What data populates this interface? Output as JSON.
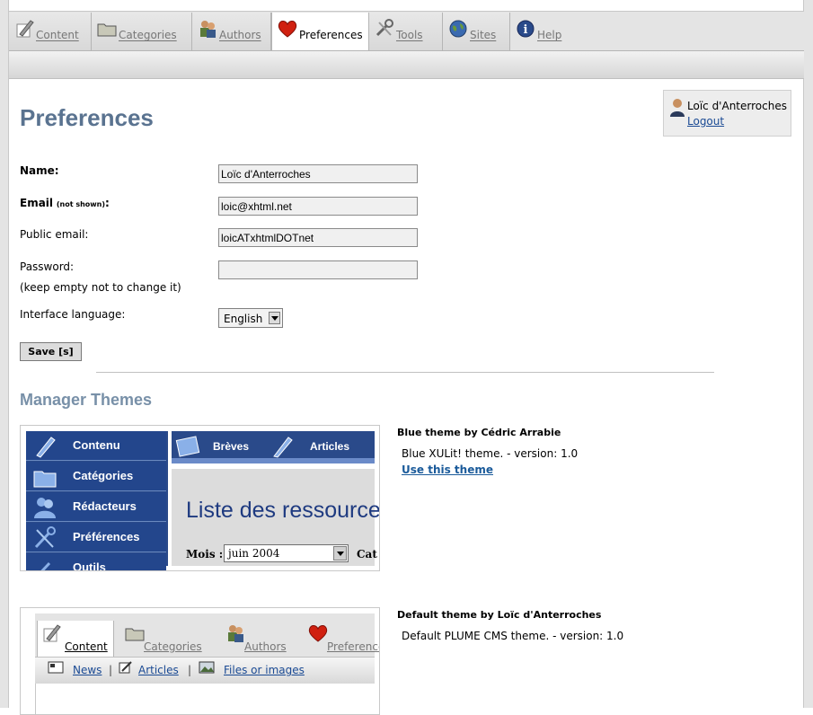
{
  "tabs": [
    {
      "label": "Content",
      "icon": "pen-icon"
    },
    {
      "label": "Categories",
      "icon": "folder-icon"
    },
    {
      "label": "Authors",
      "icon": "authors-icon"
    },
    {
      "label": "Preferences",
      "icon": "heart-icon",
      "active": true
    },
    {
      "label": "Tools",
      "icon": "tools-icon"
    },
    {
      "label": "Sites",
      "icon": "globe-icon"
    },
    {
      "label": "Help",
      "icon": "info-icon"
    }
  ],
  "user": {
    "name": "Loïc d'Anterroches",
    "logout": "Logout"
  },
  "page_title": "Preferences",
  "form": {
    "name_label": "Name:",
    "name_value": "Loïc d'Anterroches",
    "email_label": "Email",
    "email_note": "(not shown)",
    "email_colon": ":",
    "email_value": "loic@xhtml.net",
    "public_email_label": "Public email:",
    "public_email_value": "loicATxhtmlDOTnet",
    "password_label": "Password:",
    "password_hint": "(keep empty not to change it)",
    "password_value": "",
    "language_label": "Interface language:",
    "language_value": "English",
    "save_label": "Save [s]"
  },
  "themes_title": "Manager Themes",
  "themes": [
    {
      "title": "Blue theme by Cédric Arrabie",
      "desc": "Blue XULit! theme. - version: 1.0",
      "action": "Use this theme",
      "preview": {
        "nav": [
          "Contenu",
          "Catégories",
          "Rédacteurs",
          "Préférences",
          "Outils"
        ],
        "top": [
          "Brèves",
          "Articles"
        ],
        "heading": "Liste des ressources",
        "mois_label": "Mois :",
        "mois_value": "juin 2004",
        "cat_label": "Cat"
      }
    },
    {
      "title": "Default theme by Loïc d'Anterroches",
      "desc": "Default PLUME CMS theme. - version: 1.0",
      "preview": {
        "tabs": [
          "Content",
          "Categories",
          "Authors",
          "Preferences"
        ],
        "sub": [
          "News",
          "Articles",
          "Files or images"
        ]
      }
    }
  ],
  "colors": {
    "title": "#5a7390",
    "section": "#7890a8",
    "link": "#1a4a94",
    "blue_theme": "#23468c"
  }
}
